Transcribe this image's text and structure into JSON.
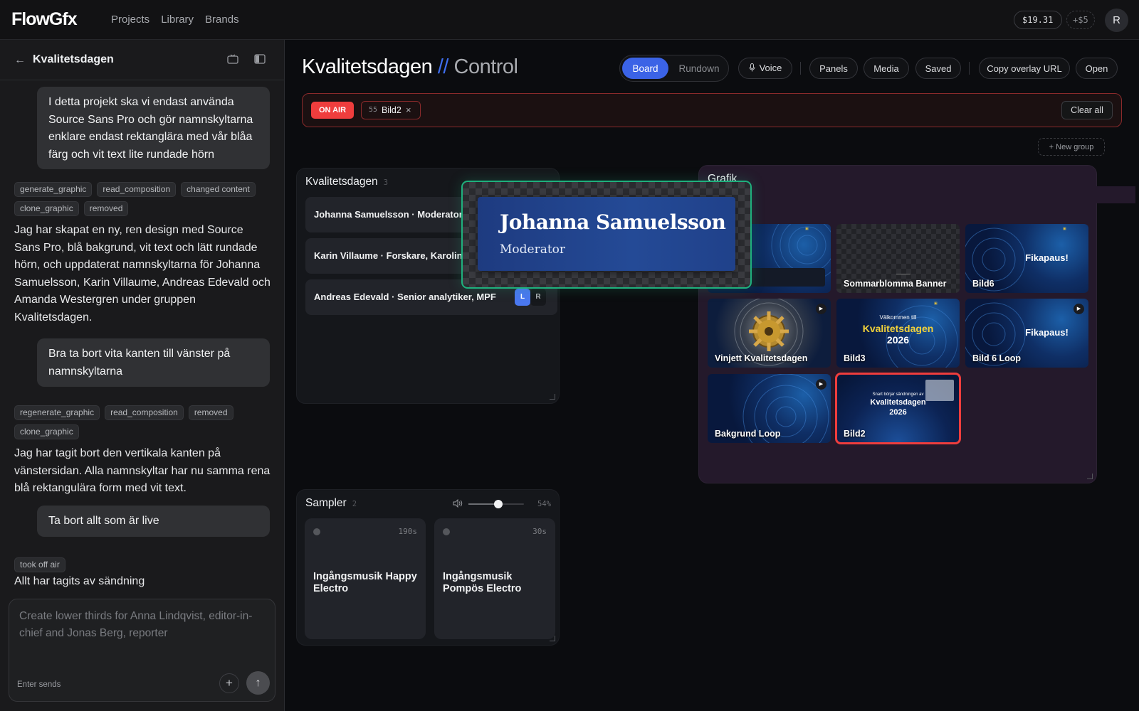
{
  "app": {
    "logo": "FlowGfx",
    "nav": [
      "Projects",
      "Library",
      "Brands"
    ],
    "balance": "$19.31",
    "add_credit": "+$5",
    "avatar_initial": "R"
  },
  "sidebar": {
    "title": "Kvalitetsdagen",
    "messages": [
      {
        "role": "user",
        "text": "I detta projekt ska vi endast använda Source Sans Pro och gör namnskyltarna enklare endast rektanglära med vår blåa färg och vit text lite rundade hörn"
      },
      {
        "role": "tools",
        "tags": [
          "generate_graphic",
          "read_composition",
          "changed content",
          "clone_graphic",
          "removed"
        ]
      },
      {
        "role": "assistant",
        "text": "Jag har skapat en ny, ren design med Source Sans Pro, blå bakgrund, vit text och lätt rundade hörn, och uppdaterat namnskyltarna för Johanna Samuelsson, Karin Villaume, Andreas Edevald och Amanda Westergren under gruppen Kvalitetsdagen."
      },
      {
        "role": "user",
        "text": "Bra ta bort vita kanten till vänster på namnskyltarna"
      },
      {
        "role": "tools",
        "tags": [
          "regenerate_graphic",
          "read_composition",
          "removed",
          "clone_graphic"
        ]
      },
      {
        "role": "assistant",
        "text": "Jag har tagit bort den vertikala kanten på vänstersidan. Alla namnskyltar har nu samma rena blå rektangulära form med vit text."
      },
      {
        "role": "user",
        "text": "Ta bort allt som är live"
      },
      {
        "role": "tools",
        "tags": [
          "took off air"
        ]
      },
      {
        "role": "assistant",
        "text": "Allt har tagits av sändning"
      }
    ],
    "composer": {
      "placeholder": "Create lower thirds for Anna Lindqvist, editor-in-chief and Jonas Berg, reporter",
      "hint": "Enter sends",
      "add": "+",
      "send": "↑"
    }
  },
  "control": {
    "title": "Kvalitetsdagen",
    "separator": "//",
    "subtitle": "Control",
    "view_tabs": [
      "Board",
      "Rundown"
    ],
    "active_view": "Board",
    "buttons": {
      "voice": "Voice",
      "panels": "Panels",
      "media": "Media",
      "saved": "Saved",
      "copy_url": "Copy overlay URL",
      "open": "Open"
    },
    "on_air": {
      "label": "ON AIR",
      "items": [
        {
          "num": "55",
          "name": "Bild2"
        }
      ],
      "clear_all": "Clear all"
    },
    "new_group": "+ New group"
  },
  "groups": {
    "lower_thirds": {
      "name": "Kvalitetsdagen",
      "count": "3",
      "rows": [
        {
          "text": "Johanna Samuelsson · Moderator"
        },
        {
          "text": "Karin Villaume · Forskare, Karolinska Institutet"
        },
        {
          "text": "Andreas Edevald · Senior analytiker, MPF"
        }
      ],
      "left": "L",
      "right": "R"
    },
    "grafik": {
      "name": "Grafik",
      "tiles": [
        {
          "label": ""
        },
        {
          "label": "Sommarblomma Banner"
        },
        {
          "label": "Bild6",
          "text": "Fikapaus!"
        },
        {
          "label": "Vinjett Kvalitetsdagen"
        },
        {
          "label": "Bild3",
          "line1": "Välkommen till",
          "line2": "Kvalitetsdagen",
          "line3": "2026"
        },
        {
          "label": "Bild 6 Loop",
          "text": "Fikapaus!"
        },
        {
          "label": "Bakgrund Loop"
        },
        {
          "label": "Bild2",
          "line1": "Snart börjar sändningen av",
          "line2": "Kvalitetsdagen",
          "line3": "2026"
        }
      ]
    },
    "sampler": {
      "name": "Sampler",
      "count": "2",
      "volume": "54%",
      "volume_level": 0.54,
      "pads": [
        {
          "title": "Ingångsmusik Happy Electro",
          "duration": "190s"
        },
        {
          "title": "Ingångsmusik Pompös Electro",
          "duration": "30s"
        }
      ]
    }
  },
  "preview": {
    "name": "Johanna Samuelsson",
    "role": "Moderator"
  },
  "colors": {
    "accent": "#3b63e6",
    "on_air": "#ef3d3d",
    "preview_border": "#1fb07d",
    "grafik_bg": "#24192b"
  }
}
